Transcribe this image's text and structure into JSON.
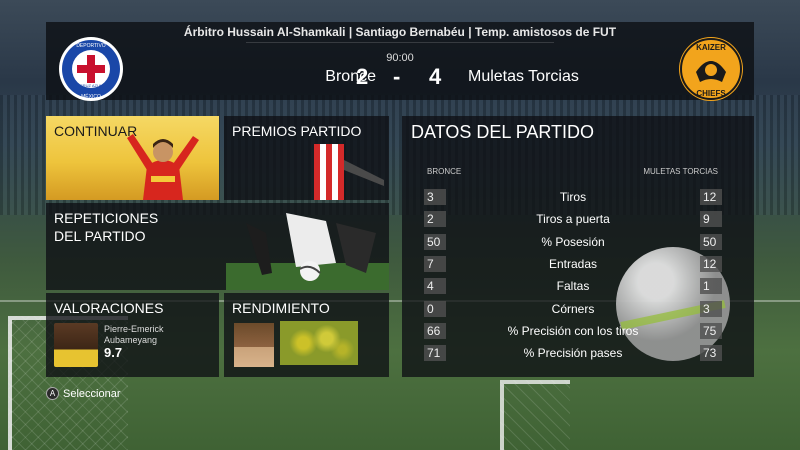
{
  "header": {
    "info": "Árbitro Hussain Al-Shamkali | Santiago Bernabéu | Temp. amistosos de FUT",
    "time": "90:00",
    "home_team": "Bronce",
    "home_score": "2",
    "dash": "-",
    "away_score": "4",
    "away_team": "Muletas Torcias"
  },
  "crests": {
    "home_text_top": "DEPORTIVO",
    "home_text_bottom": "CRUZ AZUL",
    "home_country": "MÉXICO",
    "away_text_top": "KAIZER",
    "away_text_bottom": "CHIEFS"
  },
  "menu": {
    "continuar": "CONTINUAR",
    "premios": "PREMIOS PARTIDO",
    "repeticiones": "REPETICIONES\nDEL PARTIDO",
    "valoraciones": "VALORACIONES",
    "rendimiento": "RENDIMIENTO"
  },
  "valoraciones": {
    "player_name": "Pierre-Emerick Aubameyang",
    "rating": "9.7"
  },
  "stats": {
    "title": "DATOS DEL PARTIDO",
    "home_label": "BRONCE",
    "away_label": "MULETAS TORCIAS",
    "rows": [
      {
        "label": "Tiros",
        "home": "3",
        "away": "12"
      },
      {
        "label": "Tiros a puerta",
        "home": "2",
        "away": "9"
      },
      {
        "label": "% Posesión",
        "home": "50",
        "away": "50"
      },
      {
        "label": "Entradas",
        "home": "7",
        "away": "12"
      },
      {
        "label": "Faltas",
        "home": "4",
        "away": "1"
      },
      {
        "label": "Córners",
        "home": "0",
        "away": "3"
      },
      {
        "label": "% Precisión con los tiros",
        "home": "66",
        "away": "75"
      },
      {
        "label": "% Precisión pases",
        "home": "71",
        "away": "73"
      }
    ]
  },
  "footer": {
    "button_glyph": "A",
    "hint": "Seleccionar"
  },
  "colors": {
    "continuar_tile": "#eec43c",
    "panel_bg": "#0e1014",
    "home_crest": "#1a47a8",
    "away_crest": "#f2a41c"
  }
}
